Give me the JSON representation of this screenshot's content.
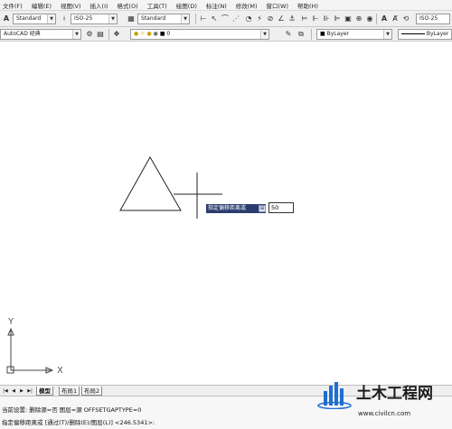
{
  "menubar": {
    "items": [
      "文件(F)",
      "编辑(E)",
      "视图(V)",
      "插入(I)",
      "格式(O)",
      "工具(T)",
      "绘图(D)",
      "标注(N)",
      "修改(M)",
      "窗口(W)",
      "帮助(H)"
    ]
  },
  "toolbar1": {
    "text_style": "Standard",
    "dim_style": "ISO-25",
    "table_style": "Standard",
    "right_dim_style": "ISO-25"
  },
  "toolbar2": {
    "workspace": "AutoCAD 经典",
    "current_layer": "0",
    "color": "ByLayer",
    "linetype": "ByLayer"
  },
  "dynamic_input": {
    "prompt": "指定偏移距离或",
    "value": "50"
  },
  "ucs": {
    "y_label": "Y",
    "x_label": "X"
  },
  "layout_tabs": {
    "nav": [
      "|◀",
      "◀",
      "▶",
      "▶|"
    ],
    "tabs": [
      "模型",
      "布局1",
      "布局2"
    ],
    "active": "模型"
  },
  "command_window": {
    "line1": "当前设置: 删除源=否  图层=源  OFFSETGAPTYPE=0",
    "line2": "指定偏移距离或 [通过(T)/删除(E)/图层(L)] <246.5341>:"
  },
  "watermark": {
    "title": "土木工程网",
    "url": "www.civilcn.com"
  },
  "colors": {
    "prompt_bg": "#2b3d6e",
    "canvas_bg": "#ffffff",
    "watermark_blue": "#1f6fd0"
  }
}
